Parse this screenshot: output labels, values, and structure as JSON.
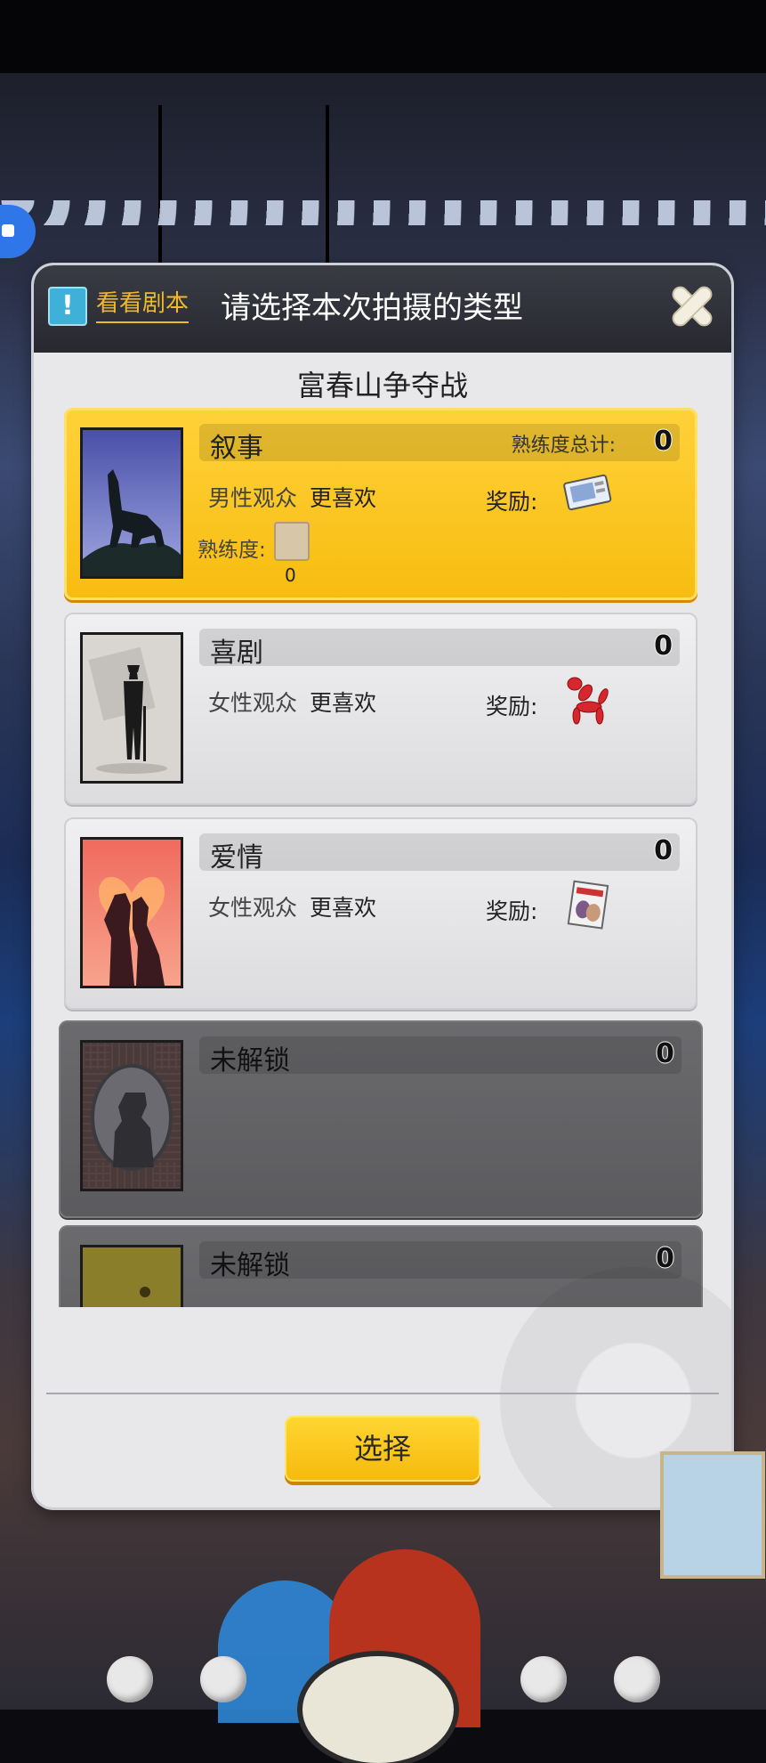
{
  "header": {
    "hint_icon": "exclamation-icon",
    "script_link": "看看剧本",
    "title": "请选择本次拍摄的类型",
    "close_icon": "close-icon"
  },
  "subtitle": "富春山争夺战",
  "genres": [
    {
      "name": "叙事",
      "selected": true,
      "total_label": "熟练度总计:",
      "total": "0",
      "audience": "男性观众",
      "preference": "更喜欢",
      "reward_label": "奖励:",
      "reward_icon": "photo-card-icon",
      "proficiency_label": "熟练度:",
      "proficiency_value": "0"
    },
    {
      "name": "喜剧",
      "total": "0",
      "audience": "女性观众",
      "preference": "更喜欢",
      "reward_label": "奖励:",
      "reward_icon": "balloon-dog-icon"
    },
    {
      "name": "爱情",
      "total": "0",
      "audience": "女性观众",
      "preference": "更喜欢",
      "reward_label": "奖励:",
      "reward_icon": "romance-magazine-icon"
    },
    {
      "name": "未解锁",
      "total": "0",
      "locked": true
    },
    {
      "name": "未解锁",
      "total": "0",
      "locked": true
    }
  ],
  "select_button": "选择",
  "colors": {
    "selected_card": "#f9c31a",
    "button_yellow": "#f6b90b",
    "link_gold": "#f0b92a"
  }
}
